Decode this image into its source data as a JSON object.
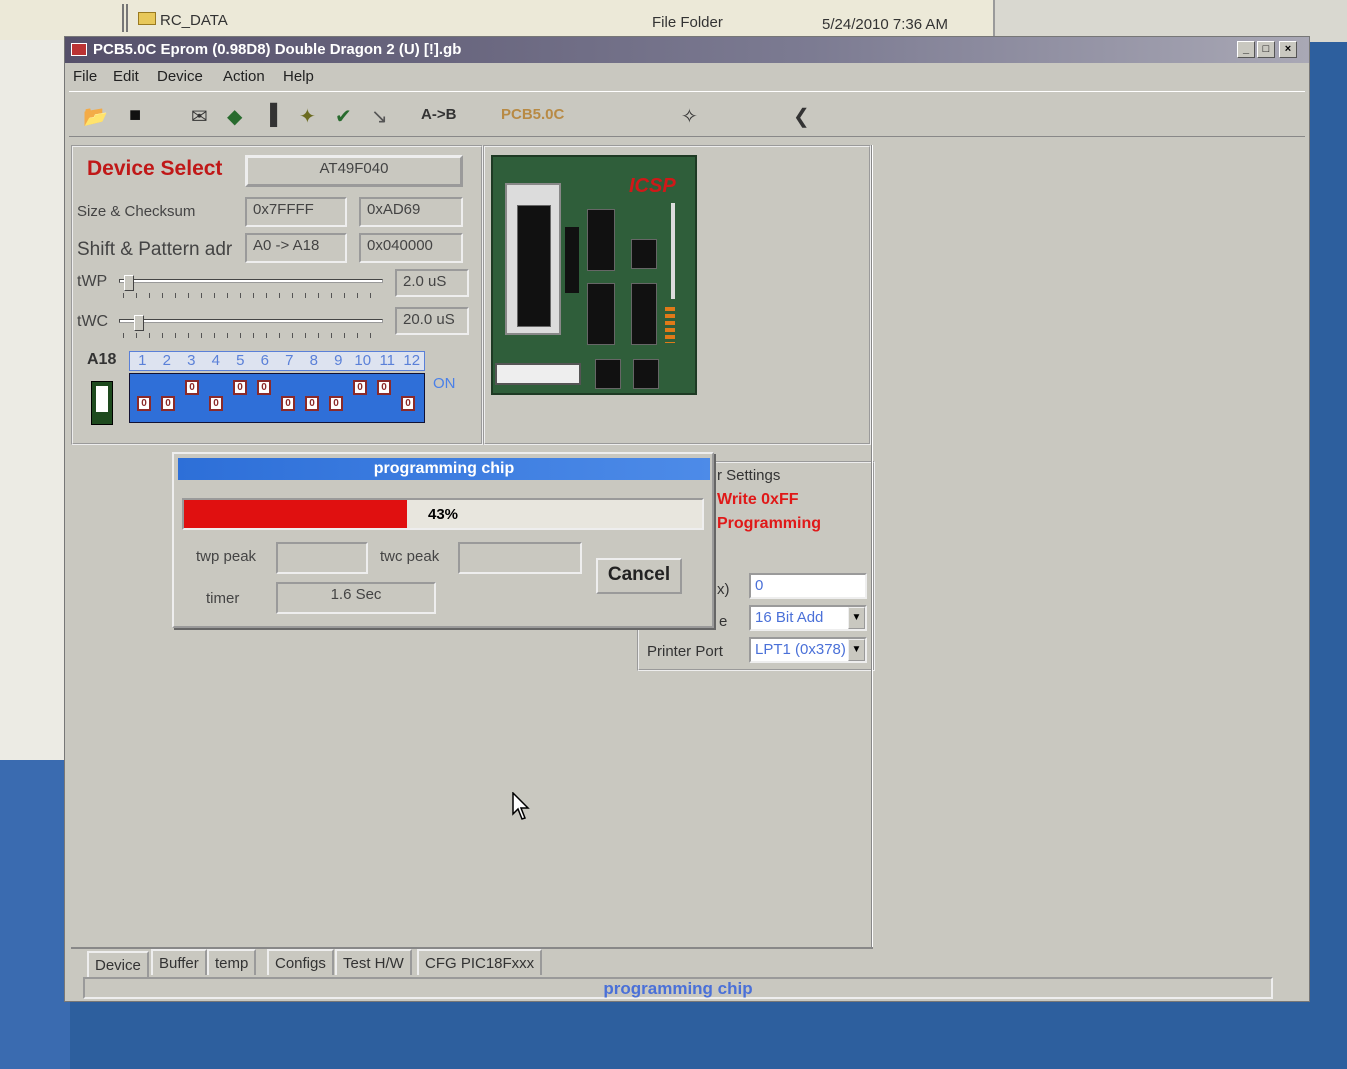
{
  "explorer": {
    "folder_name": "RC_DATA",
    "type": "File Folder",
    "date": "5/24/2010 7:36 AM"
  },
  "window": {
    "title": "PCB5.0C Eprom (0.98D8)    Double Dragon 2 (U) [!].gb",
    "buttons": {
      "min": "_",
      "max": "□",
      "close": "×"
    }
  },
  "menu": [
    "File",
    "Edit",
    "Device",
    "Action",
    "Help"
  ],
  "toolbar": {
    "ab": "A->B",
    "brand": "PCB5.0C"
  },
  "device": {
    "select_label": "Device Select",
    "device_name": "AT49F040",
    "size_label": "Size & Checksum",
    "size": "0x7FFFF",
    "checksum": "0xAD69",
    "shift_label": "Shift & Pattern adr",
    "shift": "A0 -> A18",
    "pattern": "0x040000",
    "twp_label": "tWP",
    "twp_value": "2.0 uS",
    "twc_label": "tWC",
    "twc_value": "20.0 uS",
    "a18_label": "A18",
    "dip_numbers": [
      "1",
      "2",
      "3",
      "4",
      "5",
      "6",
      "7",
      "8",
      "9",
      "10",
      "11",
      "12"
    ],
    "dip_states": [
      0,
      0,
      1,
      0,
      1,
      1,
      0,
      0,
      0,
      1,
      1,
      0
    ],
    "dip_on": "ON",
    "twp_level": 0.02,
    "twc_level": 0.06
  },
  "board": {
    "label": "ICSP"
  },
  "dialog": {
    "title": "programming chip",
    "progress": 43,
    "progress_text": "43%",
    "twp_peak_label": "twp peak",
    "twp_peak": "",
    "twc_peak_label": "twc peak",
    "twc_peak": "",
    "timer_label": "timer",
    "timer": "1.6 Sec",
    "cancel": "Cancel"
  },
  "settings": {
    "title_partial": "r Settings",
    "write": "Write 0xFF",
    "programming": "Programming",
    "x_label_partial": "x)",
    "x_value": "0",
    "mode_label_partial": "e",
    "mode_value": "16 Bit Add",
    "printer_label": "Printer Port",
    "printer_value": "LPT1 (0x378)"
  },
  "tabs": [
    "Device",
    "Buffer",
    "temp",
    "Configs",
    "Test H/W",
    "CFG PIC18Fxxx"
  ],
  "status": "programming chip",
  "colors": {
    "progress": "#e01010",
    "accent_blue": "#2d6fd8",
    "red_label": "#e01818"
  }
}
